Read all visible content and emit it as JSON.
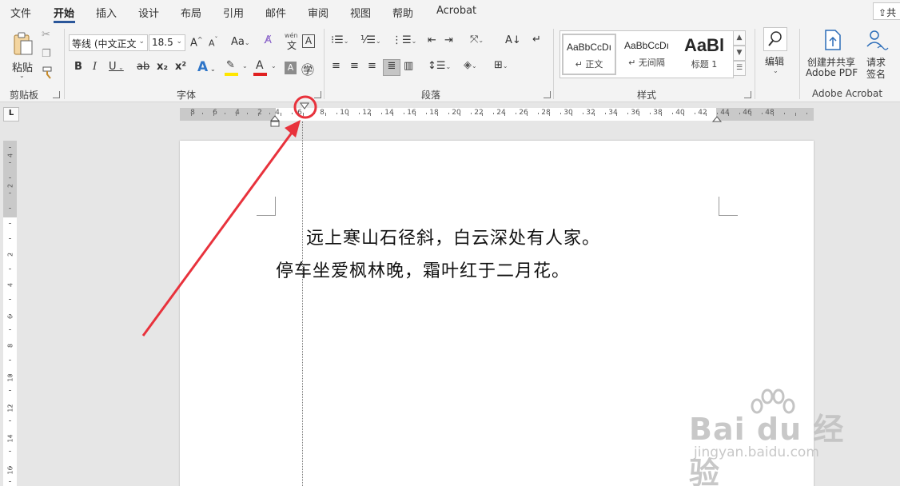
{
  "tabs": [
    {
      "label": "文件"
    },
    {
      "label": "开始"
    },
    {
      "label": "插入"
    },
    {
      "label": "设计"
    },
    {
      "label": "布局"
    },
    {
      "label": "引用"
    },
    {
      "label": "邮件"
    },
    {
      "label": "审阅"
    },
    {
      "label": "视图"
    },
    {
      "label": "帮助"
    },
    {
      "label": "Acrobat"
    }
  ],
  "active_tab": "开始",
  "share_label": "共",
  "clipboard": {
    "paste_label": "粘贴",
    "group_label": "剪贴板"
  },
  "font": {
    "name": "等线 (中文正文",
    "size": "18.5",
    "grow": "A",
    "shrink": "A",
    "change_case": "Aa",
    "bold": "B",
    "italic": "I",
    "underline": "U",
    "strike": "ab",
    "subscript": "x₂",
    "superscript": "x²",
    "phonetic": "wén",
    "group_label": "字体",
    "highlight_color": "#ffe600",
    "font_color": "#e02020"
  },
  "paragraph": {
    "group_label": "段落"
  },
  "styles": {
    "items": [
      {
        "sample": "AaBbCcDı",
        "name": "↵ 正文"
      },
      {
        "sample": "AaBbCcDı",
        "name": "↵ 无间隔"
      },
      {
        "sample": "AaBl",
        "name": "标题 1"
      }
    ],
    "group_label": "样式"
  },
  "editing": {
    "label": "编辑"
  },
  "acrobat": {
    "create_label_1": "创建并共享",
    "create_label_2": "Adobe PDF",
    "sign_label_1": "请求",
    "sign_label_2": "签名",
    "group_label": "Adobe Acrobat"
  },
  "ruler": {
    "corner": "L",
    "left_numbers": [
      "8",
      "6",
      "4",
      "2"
    ],
    "right_numbers": [
      "4",
      "6",
      "8",
      "10",
      "12",
      "14",
      "16",
      "18",
      "20",
      "22",
      "24",
      "26",
      "28",
      "30",
      "32",
      "34",
      "36",
      "38",
      "40",
      "42",
      "44",
      "46",
      "48"
    ],
    "vertical_numbers": [
      "4",
      "2",
      "2",
      "4",
      "6",
      "8",
      "10",
      "12",
      "14",
      "16"
    ]
  },
  "document": {
    "lines": [
      "远上寒山石径斜，白云深处有人家。",
      "停车坐爱枫林晚，霜叶红于二月花。"
    ]
  },
  "annotation": {
    "color": "#e8323c"
  },
  "watermark": {
    "brand": "Bai du 经验",
    "url": "jingyan.baidu.com"
  }
}
